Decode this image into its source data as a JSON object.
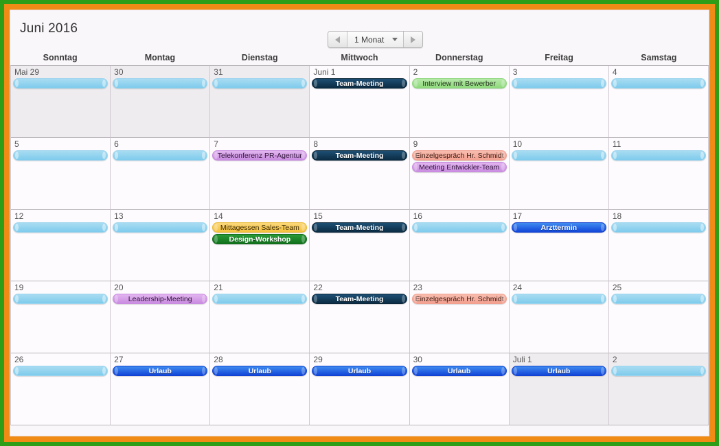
{
  "frame": {
    "outer_color": "#2e9e18",
    "inner_color": "#f08c15"
  },
  "header": {
    "title": "Juni 2016",
    "nav": {
      "prev_icon": "triangle-left-icon",
      "next_icon": "triangle-right-icon",
      "range_label": "1 Monat",
      "dropdown_icon": "chevron-down-icon"
    }
  },
  "weekdays": [
    "Sonntag",
    "Montag",
    "Dienstag",
    "Mittwoch",
    "Donnerstag",
    "Freitag",
    "Samstag"
  ],
  "event_colors": {
    "placeholder": "#7fcbec",
    "navy": "#0b2c44",
    "green_light": "#8ed97c",
    "purple": "#c98ce0",
    "salmon": "#f3a191",
    "gold": "#f5c13d",
    "green_dark": "#11721d",
    "blue": "#1245d8"
  },
  "weeks": [
    {
      "days": [
        {
          "label": "Mai 29",
          "outside": true,
          "events": [
            {
              "title": "",
              "style": "placeholder"
            }
          ]
        },
        {
          "label": "30",
          "outside": true,
          "events": [
            {
              "title": "",
              "style": "placeholder"
            }
          ]
        },
        {
          "label": "31",
          "outside": true,
          "events": [
            {
              "title": "",
              "style": "placeholder"
            }
          ]
        },
        {
          "label": "Juni 1",
          "outside": false,
          "events": [
            {
              "title": "Team-Meeting",
              "style": "navy"
            }
          ]
        },
        {
          "label": "2",
          "outside": false,
          "events": [
            {
              "title": "Interview mit Bewerber",
              "style": "green-light"
            }
          ]
        },
        {
          "label": "3",
          "outside": false,
          "events": [
            {
              "title": "",
              "style": "placeholder"
            }
          ]
        },
        {
          "label": "4",
          "outside": false,
          "events": [
            {
              "title": "",
              "style": "placeholder"
            }
          ]
        }
      ]
    },
    {
      "days": [
        {
          "label": "5",
          "outside": false,
          "events": [
            {
              "title": "",
              "style": "placeholder"
            }
          ]
        },
        {
          "label": "6",
          "outside": false,
          "events": [
            {
              "title": "",
              "style": "placeholder"
            }
          ]
        },
        {
          "label": "7",
          "outside": false,
          "events": [
            {
              "title": "Telekonferenz PR-Agentur",
              "style": "purple"
            }
          ]
        },
        {
          "label": "8",
          "outside": false,
          "events": [
            {
              "title": "Team-Meeting",
              "style": "navy"
            }
          ]
        },
        {
          "label": "9",
          "outside": false,
          "events": [
            {
              "title": "Einzelgespräch Hr. Schmidt",
              "style": "salmon"
            },
            {
              "title": "Meeting Entwickler-Team",
              "style": "purple"
            }
          ]
        },
        {
          "label": "10",
          "outside": false,
          "events": [
            {
              "title": "",
              "style": "placeholder"
            }
          ]
        },
        {
          "label": "11",
          "outside": false,
          "events": [
            {
              "title": "",
              "style": "placeholder"
            }
          ]
        }
      ]
    },
    {
      "days": [
        {
          "label": "12",
          "outside": false,
          "events": [
            {
              "title": "",
              "style": "placeholder"
            }
          ]
        },
        {
          "label": "13",
          "outside": false,
          "events": [
            {
              "title": "",
              "style": "placeholder"
            }
          ]
        },
        {
          "label": "14",
          "outside": false,
          "events": [
            {
              "title": "Mittagessen Sales-Team",
              "style": "gold"
            },
            {
              "title": "Design-Workshop",
              "style": "green-dark"
            }
          ]
        },
        {
          "label": "15",
          "outside": false,
          "events": [
            {
              "title": "Team-Meeting",
              "style": "navy"
            }
          ]
        },
        {
          "label": "16",
          "outside": false,
          "events": [
            {
              "title": "",
              "style": "placeholder"
            }
          ]
        },
        {
          "label": "17",
          "outside": false,
          "events": [
            {
              "title": "Arzttermin",
              "style": "blue"
            }
          ]
        },
        {
          "label": "18",
          "outside": false,
          "events": [
            {
              "title": "",
              "style": "placeholder"
            }
          ]
        }
      ]
    },
    {
      "days": [
        {
          "label": "19",
          "outside": false,
          "events": [
            {
              "title": "",
              "style": "placeholder"
            }
          ]
        },
        {
          "label": "20",
          "outside": false,
          "events": [
            {
              "title": "Leadership-Meeting",
              "style": "purple"
            }
          ]
        },
        {
          "label": "21",
          "outside": false,
          "events": [
            {
              "title": "",
              "style": "placeholder"
            }
          ]
        },
        {
          "label": "22",
          "outside": false,
          "events": [
            {
              "title": "Team-Meeting",
              "style": "navy"
            }
          ]
        },
        {
          "label": "23",
          "outside": false,
          "events": [
            {
              "title": "Einzelgespräch Hr. Schmidt",
              "style": "salmon"
            }
          ]
        },
        {
          "label": "24",
          "outside": false,
          "events": [
            {
              "title": "",
              "style": "placeholder"
            }
          ]
        },
        {
          "label": "25",
          "outside": false,
          "events": [
            {
              "title": "",
              "style": "placeholder"
            }
          ]
        }
      ]
    },
    {
      "days": [
        {
          "label": "26",
          "outside": false,
          "events": [
            {
              "title": "",
              "style": "placeholder"
            }
          ]
        },
        {
          "label": "27",
          "outside": false,
          "events": [
            {
              "title": "Urlaub",
              "style": "blue"
            }
          ]
        },
        {
          "label": "28",
          "outside": false,
          "events": [
            {
              "title": "Urlaub",
              "style": "blue"
            }
          ]
        },
        {
          "label": "29",
          "outside": false,
          "events": [
            {
              "title": "Urlaub",
              "style": "blue"
            }
          ]
        },
        {
          "label": "30",
          "outside": false,
          "events": [
            {
              "title": "Urlaub",
              "style": "blue"
            }
          ]
        },
        {
          "label": "Juli 1",
          "outside": true,
          "events": [
            {
              "title": "Urlaub",
              "style": "blue"
            }
          ]
        },
        {
          "label": "2",
          "outside": true,
          "events": [
            {
              "title": "",
              "style": "placeholder"
            }
          ]
        }
      ]
    }
  ]
}
